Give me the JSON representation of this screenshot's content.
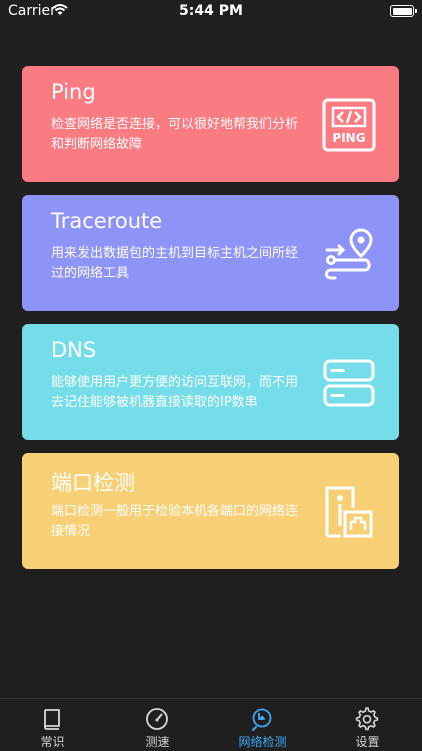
{
  "status_bar": {
    "carrier": "Carrier",
    "time": "5:44 PM"
  },
  "cards": [
    {
      "title": "Ping",
      "description": "检查网络是否连接，可以很好地帮我们分析和判断网络故障",
      "icon": "ping-code-icon",
      "icon_text": "PING",
      "color": "#fb7b82"
    },
    {
      "title": "Traceroute",
      "description": "用来发出数据包的主机到目标主机之间所经过的网络工具",
      "icon": "route-pin-icon",
      "color": "#8d93f7"
    },
    {
      "title": "DNS",
      "description": "能够使用用户更方便的访问互联网，而不用去记住能够被机器直接读取的IP数串",
      "icon": "server-icon",
      "color": "#74dde9"
    },
    {
      "title": "端口检测",
      "description": "端口检测一般用于检验本机各端口的网络连接情况",
      "icon": "port-socket-icon",
      "color": "#f7cf75"
    }
  ],
  "tabs": [
    {
      "label": "常识",
      "icon": "book-icon",
      "active": false
    },
    {
      "label": "测速",
      "icon": "speedometer-icon",
      "active": false
    },
    {
      "label": "网络检测",
      "icon": "network-check-icon",
      "active": true
    },
    {
      "label": "设置",
      "icon": "gear-icon",
      "active": false
    }
  ],
  "colors": {
    "background": "#1f1f1f",
    "tab_active": "#3fa9f5",
    "tab_inactive": "#d8d8d8"
  }
}
